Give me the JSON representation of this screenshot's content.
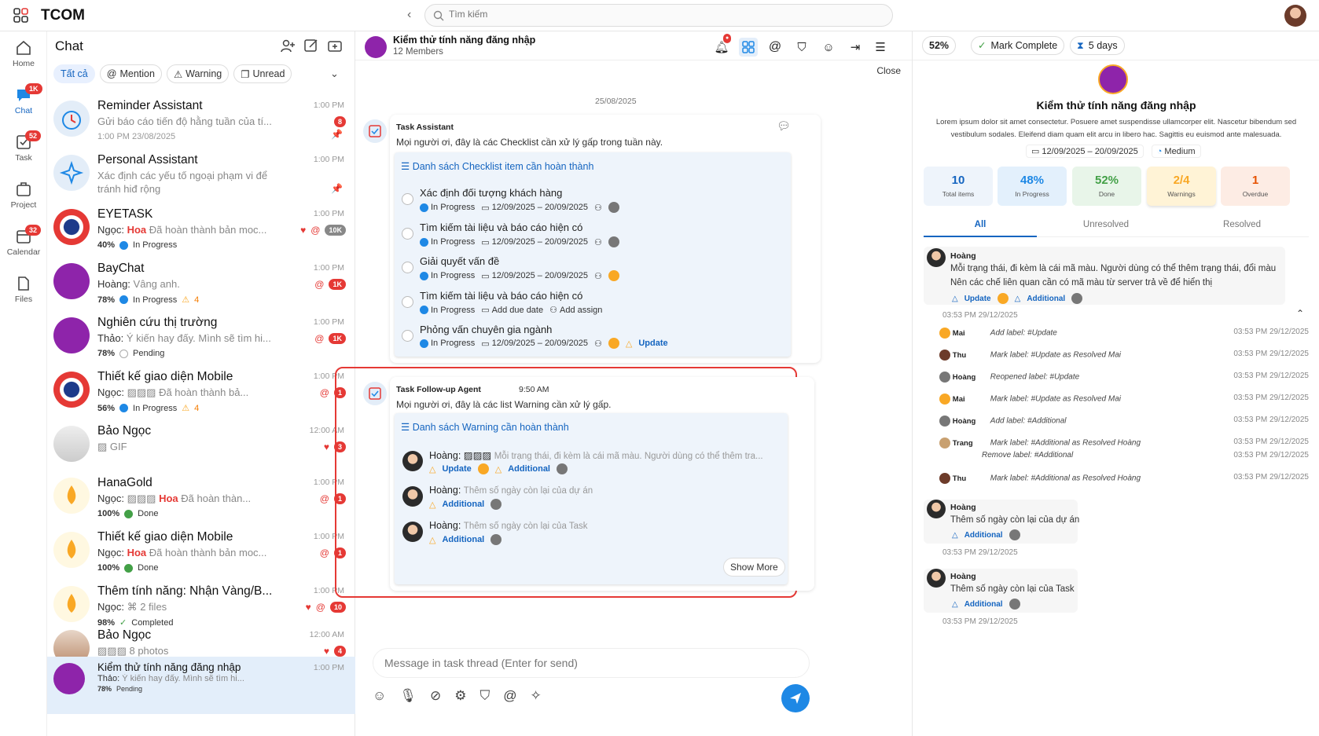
{
  "app": {
    "name": "TCOM",
    "search_placeholder": "Tìm kiếm"
  },
  "nav": [
    {
      "label": "Home",
      "icon": "home-icon"
    },
    {
      "label": "Chat",
      "icon": "chat-icon",
      "badge": "1K"
    },
    {
      "label": "Task",
      "icon": "task-icon",
      "badge": "52"
    },
    {
      "label": "Project",
      "icon": "project-icon"
    },
    {
      "label": "Calendar",
      "icon": "calendar-icon",
      "badge": "32"
    },
    {
      "label": "Files",
      "icon": "files-icon"
    }
  ],
  "chatlist": {
    "title": "Chat",
    "filters": [
      "Tất cả",
      "Mention",
      "Warning",
      "Unread"
    ],
    "rows": [
      {
        "name": "Reminder Assistant",
        "msg": "Gửi báo cáo tiến độ hằng tuần của tí...",
        "meta": "1:00 PM 23/08/2025",
        "time": "1:00 PM",
        "badge": "8"
      },
      {
        "name": "Personal Assistant",
        "msg": "Xác định các yếu tố ngoại phạm vi để",
        "msg2": "tránh hiđ rộng",
        "time": "1:00 PM"
      },
      {
        "name": "EYETASK",
        "sender": "Ngọc:",
        "hl": "Hoa",
        "msg": "Đã hoàn thành bản moc...",
        "pct": "40%",
        "status": "In Progress",
        "time": "1:00 PM",
        "badge": "10K"
      },
      {
        "name": "BayChat",
        "sender": "Hoàng:",
        "msg": "Vâng anh.",
        "pct": "78%",
        "status": "In Progress",
        "warn": "4",
        "time": "1:00 PM",
        "badge": "1K"
      },
      {
        "name": "Nghiên cứu thị trường",
        "sender": "Thảo:",
        "msg": "Ý kiến hay đấy. Mình sẽ tìm hi...",
        "pct": "78%",
        "status": "Pending",
        "time": "1:00 PM",
        "badge": "1K"
      },
      {
        "name": "Thiết kế giao diện Mobile",
        "sender": "Ngọc:",
        "msg": "Đã hoàn thành bả...",
        "pct": "56%",
        "status": "In Progress",
        "warn": "4",
        "time": "1:00 PM",
        "badge": "1"
      },
      {
        "name": "Bảo Ngọc",
        "msg": "GIF",
        "time": "12:00 AM",
        "badge": "3"
      },
      {
        "name": "HanaGold",
        "sender": "Ngọc:",
        "hl": "Hoa",
        "msg": "Đã hoàn thàn...",
        "pct": "100%",
        "status": "Done",
        "time": "1:00 PM",
        "badge": "1"
      },
      {
        "name": "Thiết kế giao diện Mobile",
        "sender": "Ngọc:",
        "hl": "Hoa",
        "msg": "Đã hoàn thành bản moc...",
        "pct": "100%",
        "status": "Done",
        "time": "1:00 PM",
        "badge": "1"
      },
      {
        "name": "Thêm tính năng: Nhận Vàng/B...",
        "sender": "Ngọc:",
        "msg": "2 files",
        "pct": "98%",
        "status": "Completed",
        "time": "1:00 PM",
        "badge": "10"
      },
      {
        "name": "Bảo Ngọc",
        "msg": "8 photos",
        "time": "12:00 AM",
        "badge": "4"
      },
      {
        "name": "Kiểm thử tính năng đăng nhập",
        "sender": "Thảo:",
        "msg": "Ý kiến hay đấy. Mình sẽ tìm hi...",
        "pct": "78%",
        "status": "Pending",
        "time": "1:00 PM"
      }
    ]
  },
  "thread": {
    "title": "Kiểm thử tính năng đăng nhập",
    "members": "12 Members",
    "close": "Close",
    "date": "25/08/2025",
    "msg1": {
      "sender": "Task Assistant",
      "text": "Mọi người ơi, đây là các Checklist cần xử lý gấp trong tuần này.",
      "list_title": "Danh sách Checklist item cần hoàn thành",
      "items": [
        {
          "title": "Xác định đối tượng khách hàng",
          "status": "In Progress",
          "date": "12/09/2025 – 20/09/2025"
        },
        {
          "title": "Tìm kiếm tài liệu và báo cáo hiện có",
          "status": "In Progress",
          "date": "12/09/2025 – 20/09/2025"
        },
        {
          "title": "Giải quyết vấn đề",
          "status": "In Progress",
          "date": "12/09/2025 – 20/09/2025"
        },
        {
          "title": "Tìm kiếm tài liệu và báo cáo hiện có",
          "status": "In Progress",
          "due": "Add due date",
          "assign": "Add assign"
        },
        {
          "title": "Phỏng vấn chuyên gia ngành",
          "status": "In Progress",
          "date": "12/09/2025 – 20/09/2025",
          "label": "Update"
        }
      ]
    },
    "msg2": {
      "sender": "Task Follow-up Agent",
      "time": "9:50 AM",
      "text": "Mọi người ơi, đây là các list Warning cần xử lý gấp.",
      "list_title": "Danh sách Warning cần hoàn thành",
      "items": [
        {
          "who": "Hoàng:",
          "text": "Mỗi trạng thái, đi kèm là cái mã màu. Người dùng có thể thêm tra...",
          "labels": [
            "Update",
            "Additional"
          ]
        },
        {
          "who": "Hoàng:",
          "text": "Thêm số ngày còn lại của dự án",
          "labels": [
            "Additional"
          ]
        },
        {
          "who": "Hoàng:",
          "text": "Thêm số ngày còn lại của Task",
          "labels": [
            "Additional"
          ]
        }
      ],
      "show_more": "Show More"
    },
    "composer_placeholder": "Message in task thread (Enter for send)"
  },
  "panel": {
    "progress": "52%",
    "mark_complete": "Mark Complete",
    "days": "5 days",
    "title": "Kiểm thử tính năng đăng nhập",
    "desc": "Lorem ipsum dolor sit amet consectetur. Posuere amet suspendisse ullamcorper elit. Nascetur bibendum sed vestibulum sodales. Eleifend diam quam elit arcu in libero hac. Sagittis eu euismod ante malesuada.",
    "dates": "12/09/2025 – 20/09/2025",
    "priority": "Medium",
    "stats": [
      {
        "value": "10",
        "label": "Total items",
        "color": "#1565c0",
        "bg": "#eef4fb"
      },
      {
        "value": "48%",
        "label": "In Progress",
        "color": "#1e88e5",
        "bg": "#e3f0fc"
      },
      {
        "value": "52%",
        "label": "Done",
        "color": "#43a047",
        "bg": "#e8f5e9"
      },
      {
        "value": "2/4",
        "label": "Warnings",
        "color": "#f9a825",
        "bg": "#fff3d6"
      },
      {
        "value": "1",
        "label": "Overdue",
        "color": "#e65100",
        "bg": "#fdece4"
      }
    ],
    "tabs": [
      "All",
      "Unresolved",
      "Resolved"
    ],
    "c1": {
      "who": "Hoàng",
      "text1": "Mỗi trạng thái, đi kèm là cái mã màu. Người dùng có thể thêm trạng thái, đổi màu",
      "text2": "Nên các chế liên quan cần có mã màu từ server trả về để hiển thị",
      "labels": [
        "Update",
        "Additional"
      ],
      "time": "03:53 PM 29/12/2025"
    },
    "history": [
      {
        "who": "Mai",
        "act": "Add label: #Update",
        "t": "03:53 PM 29/12/2025"
      },
      {
        "who": "Thu",
        "act": "Mark label: #Update as Resolved Mai",
        "t": "03:53 PM 29/12/2025"
      },
      {
        "who": "Hoàng",
        "act": "Reopened label: #Update",
        "t": "03:53 PM 29/12/2025"
      },
      {
        "who": "Mai",
        "act": "Mark label: #Update as Resolved Mai",
        "t": "03:53 PM 29/12/2025"
      },
      {
        "who": "Hoàng",
        "act": "Add label: #Additional",
        "t": "03:53 PM 29/12/2025"
      },
      {
        "who": "Trang",
        "act": "Mark label: #Additional as Resolved Hoàng",
        "act2": "Remove label: #Additional",
        "t": "03:53 PM 29/12/2025",
        "t2": "03:53 PM 29/12/2025"
      },
      {
        "who": "Thu",
        "act": "Mark label: #Additional as Resolved Hoàng",
        "t": "03:53 PM 29/12/2025"
      }
    ],
    "c2": {
      "who": "Hoàng",
      "text": "Thêm số ngày còn lại của dự án",
      "label": "Additional",
      "time": "03:53 PM 29/12/2025"
    },
    "c3": {
      "who": "Hoàng",
      "text": "Thêm số ngày còn lại của Task",
      "label": "Additional",
      "time": "03:53 PM 29/12/2025"
    }
  }
}
